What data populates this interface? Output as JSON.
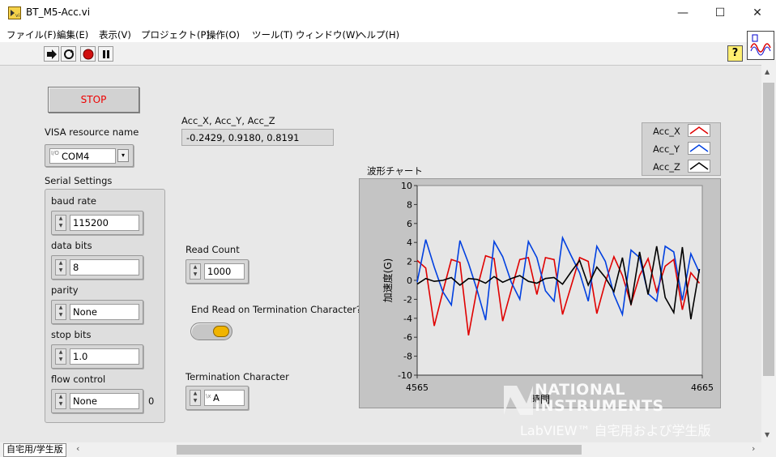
{
  "window": {
    "title": "BT_M5-Acc.vi",
    "minimize": "—",
    "maximize": "☐",
    "close": "✕"
  },
  "menu": [
    "ファイル(F)",
    "編集(E)",
    "表示(V)",
    "プロジェクト(P)",
    "操作(O)",
    "ツール(T)",
    "ウィンドウ(W)",
    "ヘルプ(H)"
  ],
  "toolbar": {
    "help": "?"
  },
  "panel": {
    "stop_label": "STOP",
    "visa_label": "VISA resource name",
    "visa_value": "COM4",
    "visa_prefix": "I/O",
    "serial_label": "Serial Settings",
    "baud_label": "baud rate",
    "baud_value": "115200",
    "databits_label": "data bits",
    "databits_value": "8",
    "parity_label": "parity",
    "parity_value": "None",
    "stopbits_label": "stop bits",
    "stopbits_value": "1.0",
    "flow_label": "flow control",
    "flow_value": "None",
    "flow_extra": "0",
    "acc_label": "Acc_X,  Acc_Y,  Acc_Z",
    "acc_value": "-0.2429,  0.9180,  0.8191",
    "read_count_label": "Read Count",
    "read_count_value": "1000",
    "end_read_label": "End Read on Termination Character?",
    "term_char_label": "Termination Character",
    "term_char_prefix": "\\x",
    "term_char_value": "A"
  },
  "status": {
    "mode": "自宅用/学生版"
  },
  "watermark": {
    "line1": "NATIONAL",
    "line2": "INSTRUMENTS",
    "line3": "LabVIEW™ 自宅用および学生版"
  },
  "colors": {
    "acc_x": "#e00000",
    "acc_y": "#0040e0",
    "acc_z": "#000000",
    "plot_bg": "#e6e6e6",
    "led_on": "#f0b400"
  },
  "chart_data": {
    "type": "line",
    "title": "波形チャート",
    "xlabel": "時間",
    "ylabel": "加速度(G)",
    "xlim": [
      4565,
      4665
    ],
    "ylim": [
      -10,
      10
    ],
    "yticks": [
      10,
      8,
      6,
      4,
      2,
      0,
      -2,
      -4,
      -6,
      -8,
      -10
    ],
    "xticks": [
      4565,
      4665
    ],
    "grid": false,
    "legend": "top-right",
    "x": [
      4565,
      4568,
      4571,
      4574,
      4577,
      4580,
      4583,
      4586,
      4589,
      4592,
      4595,
      4598,
      4601,
      4604,
      4607,
      4610,
      4613,
      4616,
      4619,
      4622,
      4625,
      4628,
      4631,
      4634,
      4637,
      4640,
      4643,
      4646,
      4649,
      4652,
      4655,
      4658,
      4661,
      4664
    ],
    "series": [
      {
        "name": "Acc_X",
        "color": "#e00000",
        "values": [
          2.1,
          1.3,
          -4.8,
          -1.2,
          2.2,
          1.9,
          -5.8,
          -0.9,
          2.6,
          2.3,
          -4.3,
          -1.0,
          2.2,
          2.4,
          -1.5,
          2.4,
          2.2,
          -3.6,
          -0.6,
          2.4,
          2.0,
          -3.5,
          -0.2,
          2.5,
          0.5,
          -2.5,
          0.5,
          2.3,
          -1.2,
          1.5,
          2.2,
          -3.1,
          0.8,
          -0.3
        ]
      },
      {
        "name": "Acc_Y",
        "color": "#0040e0",
        "values": [
          -0.2,
          4.3,
          1.4,
          -1.2,
          -2.6,
          4.2,
          1.8,
          -1.0,
          -4.2,
          4.1,
          2.5,
          -0.2,
          -2.0,
          4.1,
          2.4,
          -1.1,
          -2.2,
          4.5,
          2.6,
          0.8,
          -2.2,
          3.6,
          2.0,
          -1.5,
          -3.6,
          3.2,
          2.4,
          -1.4,
          -2.2,
          3.6,
          3.0,
          -2.1,
          2.8,
          0.8
        ]
      },
      {
        "name": "Acc_Z",
        "color": "#000000",
        "values": [
          -0.4,
          0.2,
          -0.1,
          0.0,
          0.3,
          -0.5,
          0.2,
          0.1,
          -0.3,
          0.4,
          -0.2,
          0.2,
          0.5,
          -0.1,
          -0.3,
          0.2,
          0.3,
          -0.4,
          0.9,
          2.1,
          -0.5,
          1.4,
          0.3,
          -1.2,
          2.4,
          -2.6,
          3.0,
          -1.5,
          3.6,
          -1.8,
          -3.4,
          3.5,
          -4.1,
          1.2
        ]
      }
    ]
  }
}
